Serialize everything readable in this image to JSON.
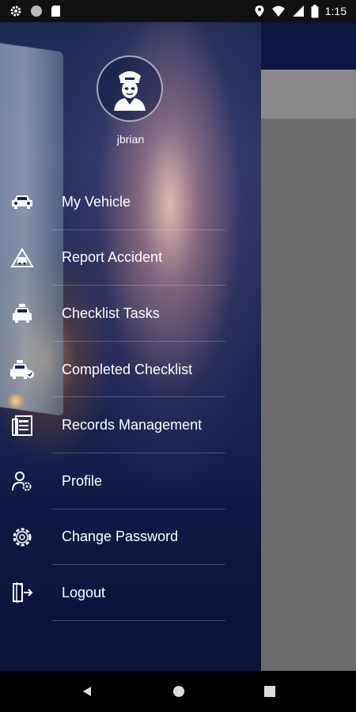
{
  "status_bar": {
    "time": "1:15",
    "icons": [
      "settings-icon",
      "circle-icon",
      "sd-card-icon",
      "location-icon",
      "wifi-icon",
      "signal-icon",
      "battery-icon"
    ]
  },
  "drawer": {
    "username": "jbrian",
    "avatar_icon": "chauffeur-avatar-icon",
    "menu": [
      {
        "label": "My Vehicle",
        "icon": "car-icon"
      },
      {
        "label": "Report Accident",
        "icon": "accident-icon"
      },
      {
        "label": "Checklist Tasks",
        "icon": "taxi-icon"
      },
      {
        "label": "Completed Checklist",
        "icon": "taxi-check-icon"
      },
      {
        "label": "Records Management",
        "icon": "records-icon"
      },
      {
        "label": "Profile",
        "icon": "profile-gear-icon"
      },
      {
        "label": "Change Password",
        "icon": "gear-icon"
      },
      {
        "label": "Logout",
        "icon": "logout-icon"
      }
    ]
  },
  "nav_bar": {
    "icons": [
      "back-icon",
      "home-icon",
      "recents-icon"
    ]
  }
}
